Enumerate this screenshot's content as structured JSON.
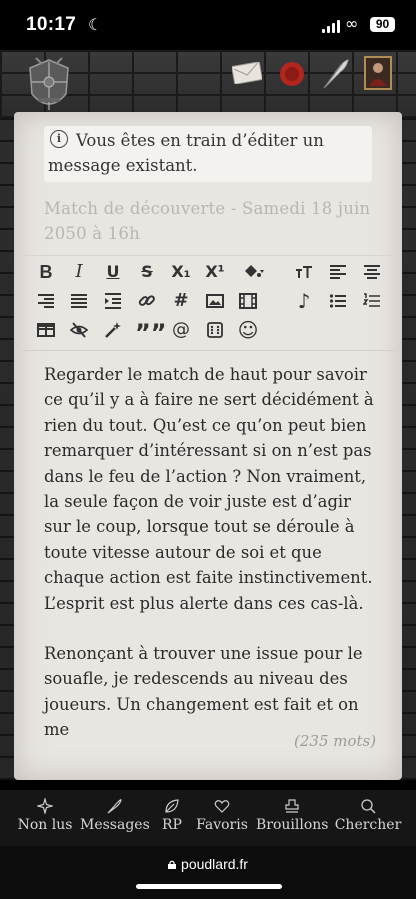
{
  "status": {
    "time": "10:17",
    "battery": "90"
  },
  "notice": {
    "text": "Vous êtes en train d’éditer un message existant."
  },
  "subject": {
    "value": "Match de découverte - Samedi 18 juin 2050 à 16h"
  },
  "toolbar": {
    "row1": [
      "B",
      "I",
      "U",
      "S",
      "X₁",
      "X¹"
    ],
    "row1_icons": [
      "fill-color-icon",
      "text-size-icon",
      "align-left-icon",
      "align-center-icon"
    ],
    "row2_icons": [
      "align-right-icon",
      "align-justify-icon",
      "indent-icon",
      "link-icon",
      "hashtag-icon",
      "image-icon",
      "video-icon",
      "music-icon",
      "bullet-list-icon",
      "numbered-list-icon"
    ],
    "row3_icons": [
      "table-icon",
      "hide-icon",
      "magic-wand-icon",
      "quote-icon",
      "mention-icon",
      "dice-icon",
      "smiley-icon"
    ],
    "hashtag": "#",
    "mention": "@",
    "quote": "””",
    "music": "♪",
    "smiley": "☺"
  },
  "editor": {
    "paragraphs": [
      "Regarder le match de haut pour savoir ce qu’il y a à faire ne sert décidément à rien du tout. Qu’est ce qu’on peut bien remarquer d’intéressant si on n’est pas dans le feu de l’action ? Non vraiment, la seule façon de voir juste est d’agir sur le coup, lorsque tout se déroule à toute vitesse autour de soi et que chaque action est faite instinctivement. L’esprit est plus alerte dans ces cas-là.",
      "Renonçant à trouver une issue pour le souafle, je redescends au niveau des joueurs. Un changement est fait et on me"
    ],
    "word_count": "(235 mots)"
  },
  "nav": [
    {
      "label": "Non lus",
      "icon": "sparkle-icon"
    },
    {
      "label": "Messages",
      "icon": "quill-icon"
    },
    {
      "label": "RP",
      "icon": "leaf-icon"
    },
    {
      "label": "Favoris",
      "icon": "heart-icon"
    },
    {
      "label": "Brouillons",
      "icon": "stamp-icon"
    },
    {
      "label": "Chercher",
      "icon": "search-icon"
    }
  ],
  "browser": {
    "url": "poudlard.fr"
  },
  "colors": {
    "parchment": "#e9e6e2",
    "brick": "#2f2f2f",
    "nav": "#161616",
    "accent_red": "#b3261e"
  }
}
